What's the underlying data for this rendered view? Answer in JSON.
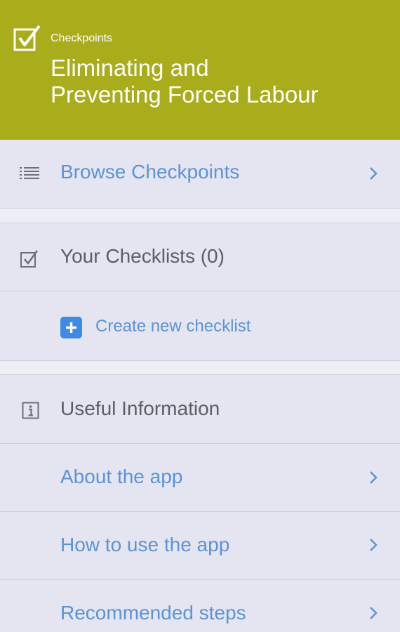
{
  "header": {
    "app_name": "Checkpoints",
    "title": "Eliminating and Preventing Forced Labour",
    "background_color": "#a9ac1b",
    "logo_icon": "checkbox-check-icon"
  },
  "menu": {
    "browse": {
      "label": "Browse Checkpoints",
      "icon": "list-icon"
    },
    "checklists": {
      "label": "Your Checklists (0)",
      "icon": "checkbox-icon",
      "create": {
        "label": "Create new checklist",
        "icon": "plus-icon"
      }
    },
    "info": {
      "label": "Useful Information",
      "icon": "info-icon",
      "items": [
        {
          "label": "About the app"
        },
        {
          "label": "How to use the app"
        },
        {
          "label": "Recommended steps"
        }
      ]
    }
  },
  "colors": {
    "link": "#5a93d8",
    "section_text": "#5d5d64",
    "background": "#e5e5f1",
    "add_button": "#3d8be4"
  }
}
